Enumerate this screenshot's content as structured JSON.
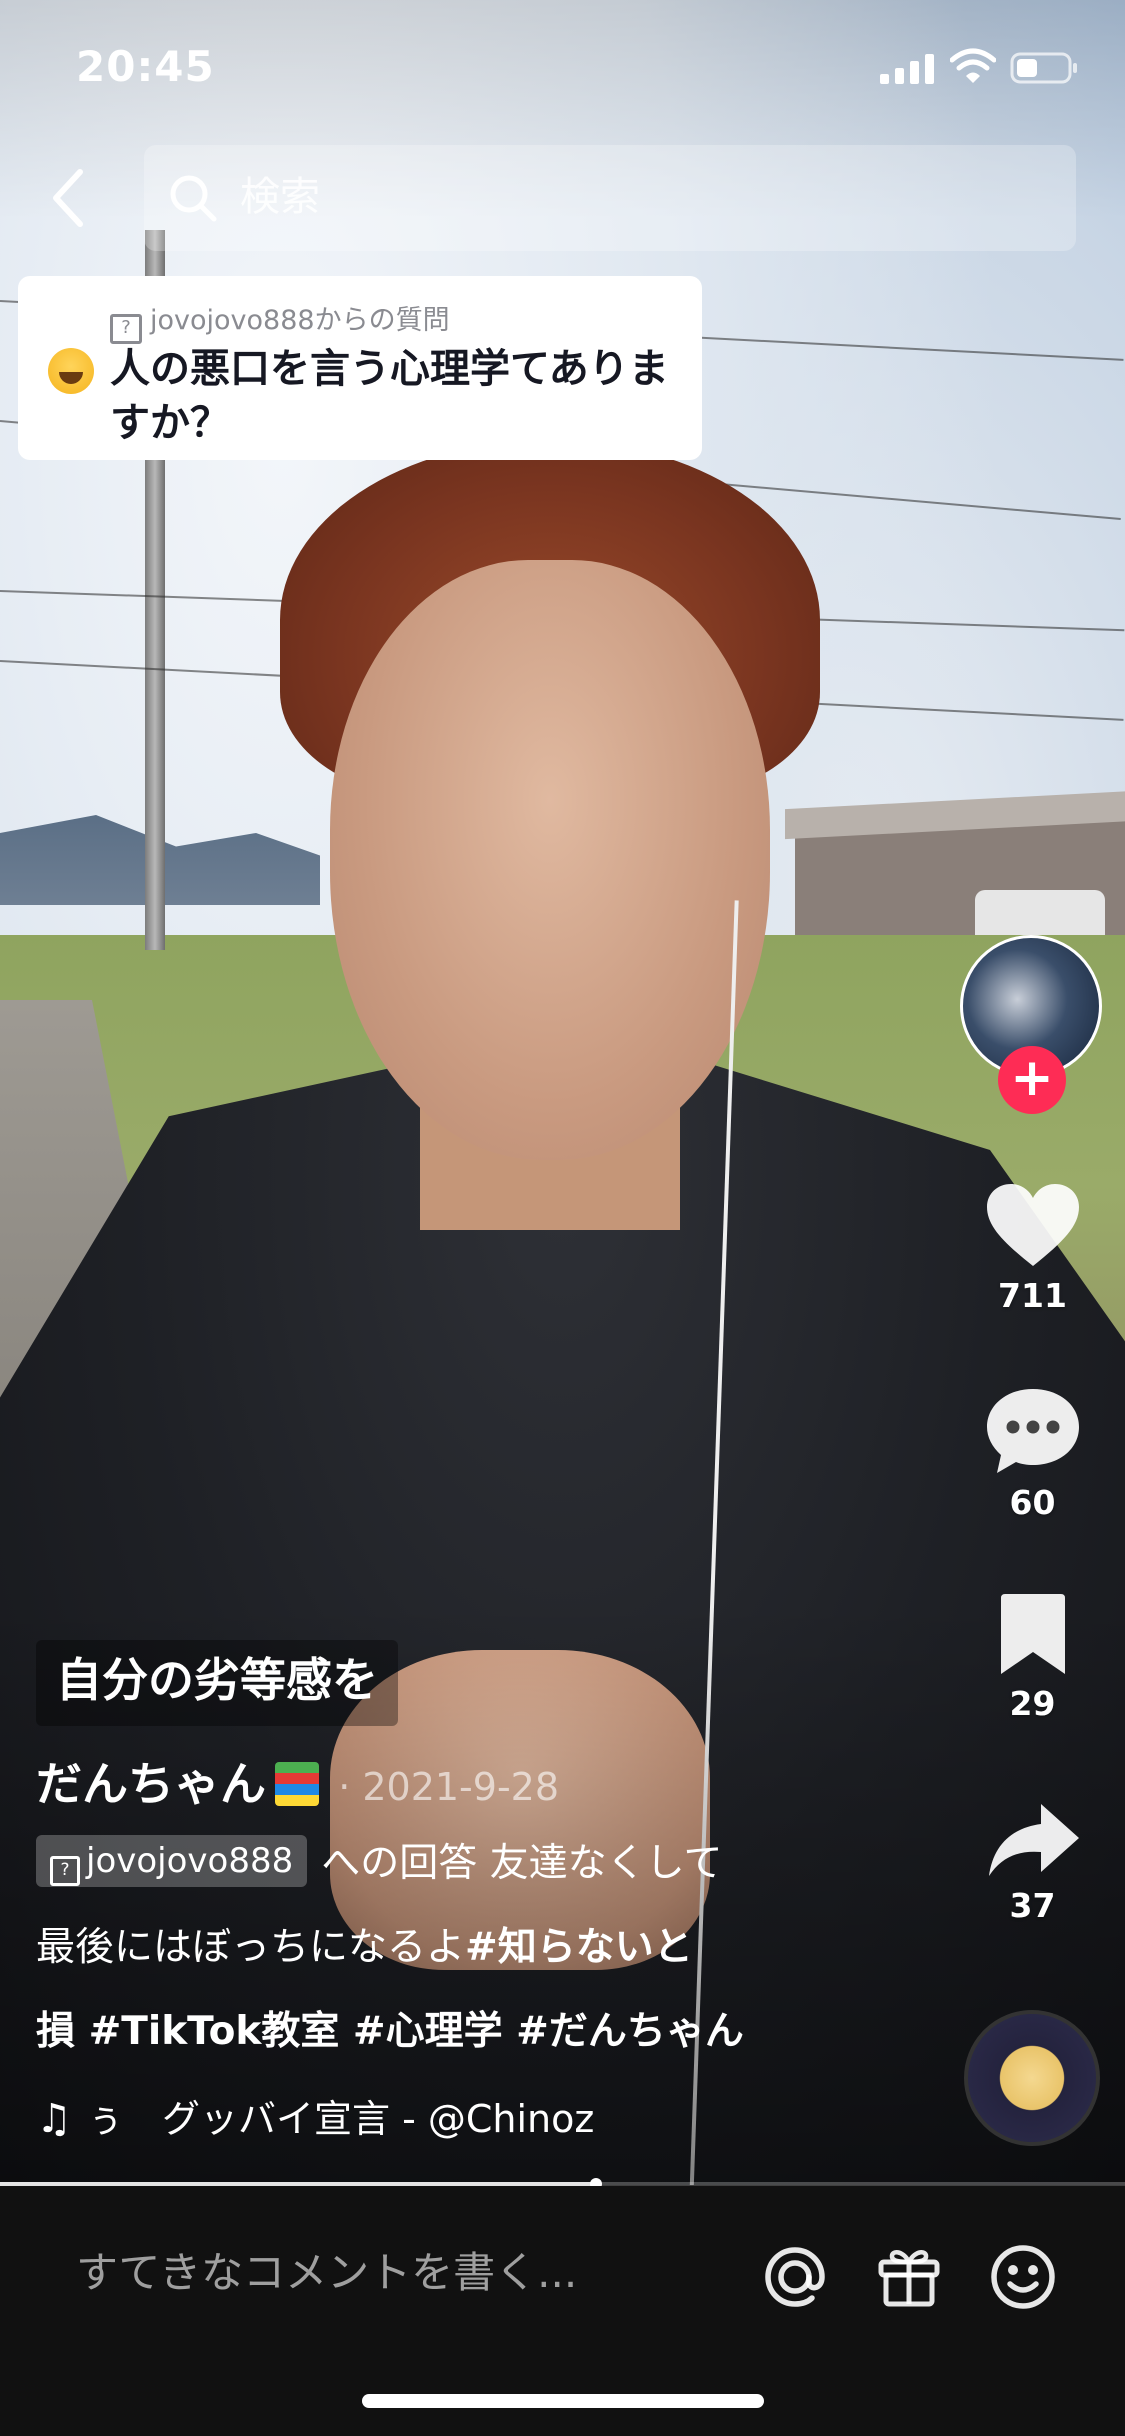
{
  "status_bar": {
    "time": "20:45"
  },
  "search": {
    "placeholder": "検索"
  },
  "question_card": {
    "header": "jovojovo888からの質問",
    "text": "人の悪口を言う心理学てありますか？"
  },
  "actions": {
    "likes": "711",
    "comments": "60",
    "saves": "29",
    "shares": "37",
    "follow_symbol": "+"
  },
  "caption": {
    "topic": "自分の劣等感を",
    "author": "だんちゃん",
    "date": "· 2021-9-28",
    "reply_chip": "jovojovo888",
    "line1_text": "への回答 友達なくして",
    "line2_text": "最後にはぼっちになるよ",
    "line2_tag": "#知らないと",
    "line3_tags": "損 #TikTok教室 #心理学 #だんちゃん",
    "music": "ぅ　グッバイ宣言 - @Chinoz"
  },
  "playback": {
    "progress_fraction": 0.53
  },
  "comment_bar": {
    "placeholder": "すてきなコメントを書く..."
  },
  "colors": {
    "accent": "#fe2c55",
    "card_bg": "#ffffff",
    "comment_bar_bg": "#111111"
  },
  "icons": [
    "back-icon",
    "search-icon",
    "heart-icon",
    "comment-icon",
    "bookmark-icon",
    "share-icon",
    "music-note-icon",
    "mention-icon",
    "gift-icon",
    "emoji-icon"
  ]
}
